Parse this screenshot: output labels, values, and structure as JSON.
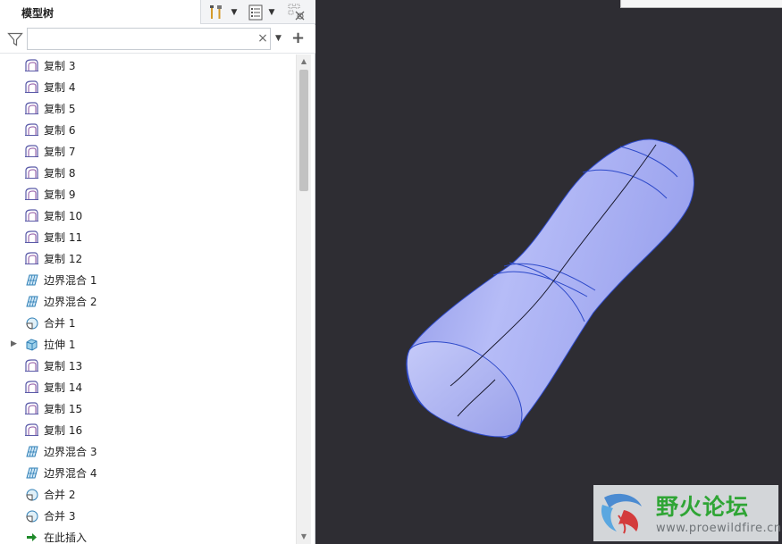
{
  "panel": {
    "tab_title": "模型树",
    "header_icons": [
      "tools-icon",
      "list-icon",
      "tree-settings-icon"
    ]
  },
  "filter": {
    "value": "",
    "placeholder": ""
  },
  "tree": {
    "items": [
      {
        "label": "复制 3",
        "icon": "copy-surface-icon"
      },
      {
        "label": "复制 4",
        "icon": "copy-surface-icon"
      },
      {
        "label": "复制 5",
        "icon": "copy-surface-icon"
      },
      {
        "label": "复制 6",
        "icon": "copy-surface-icon"
      },
      {
        "label": "复制 7",
        "icon": "copy-surface-icon"
      },
      {
        "label": "复制 8",
        "icon": "copy-surface-icon"
      },
      {
        "label": "复制 9",
        "icon": "copy-surface-icon"
      },
      {
        "label": "复制 10",
        "icon": "copy-surface-icon"
      },
      {
        "label": "复制 11",
        "icon": "copy-surface-icon"
      },
      {
        "label": "复制 12",
        "icon": "copy-surface-icon"
      },
      {
        "label": "边界混合 1",
        "icon": "boundary-blend-icon"
      },
      {
        "label": "边界混合 2",
        "icon": "boundary-blend-icon"
      },
      {
        "label": "合并 1",
        "icon": "merge-icon"
      },
      {
        "label": "拉伸 1",
        "icon": "extrude-icon",
        "expandable": true
      },
      {
        "label": "复制 13",
        "icon": "copy-surface-icon"
      },
      {
        "label": "复制 14",
        "icon": "copy-surface-icon"
      },
      {
        "label": "复制 15",
        "icon": "copy-surface-icon"
      },
      {
        "label": "复制 16",
        "icon": "copy-surface-icon"
      },
      {
        "label": "边界混合 3",
        "icon": "boundary-blend-icon"
      },
      {
        "label": "边界混合 4",
        "icon": "boundary-blend-icon"
      },
      {
        "label": "合并 2",
        "icon": "merge-icon"
      },
      {
        "label": "合并 3",
        "icon": "merge-icon"
      },
      {
        "label": "在此插入",
        "icon": "insert-here-arrow-icon"
      }
    ]
  },
  "watermark": {
    "name": "野火论坛",
    "url": "www.proewildfire.cn"
  },
  "colors": {
    "viewport_bg": "#2e2d33",
    "model_fill": "#a4abf4",
    "model_edge": "#2d49c9",
    "watermark_green": "#2fa535"
  }
}
